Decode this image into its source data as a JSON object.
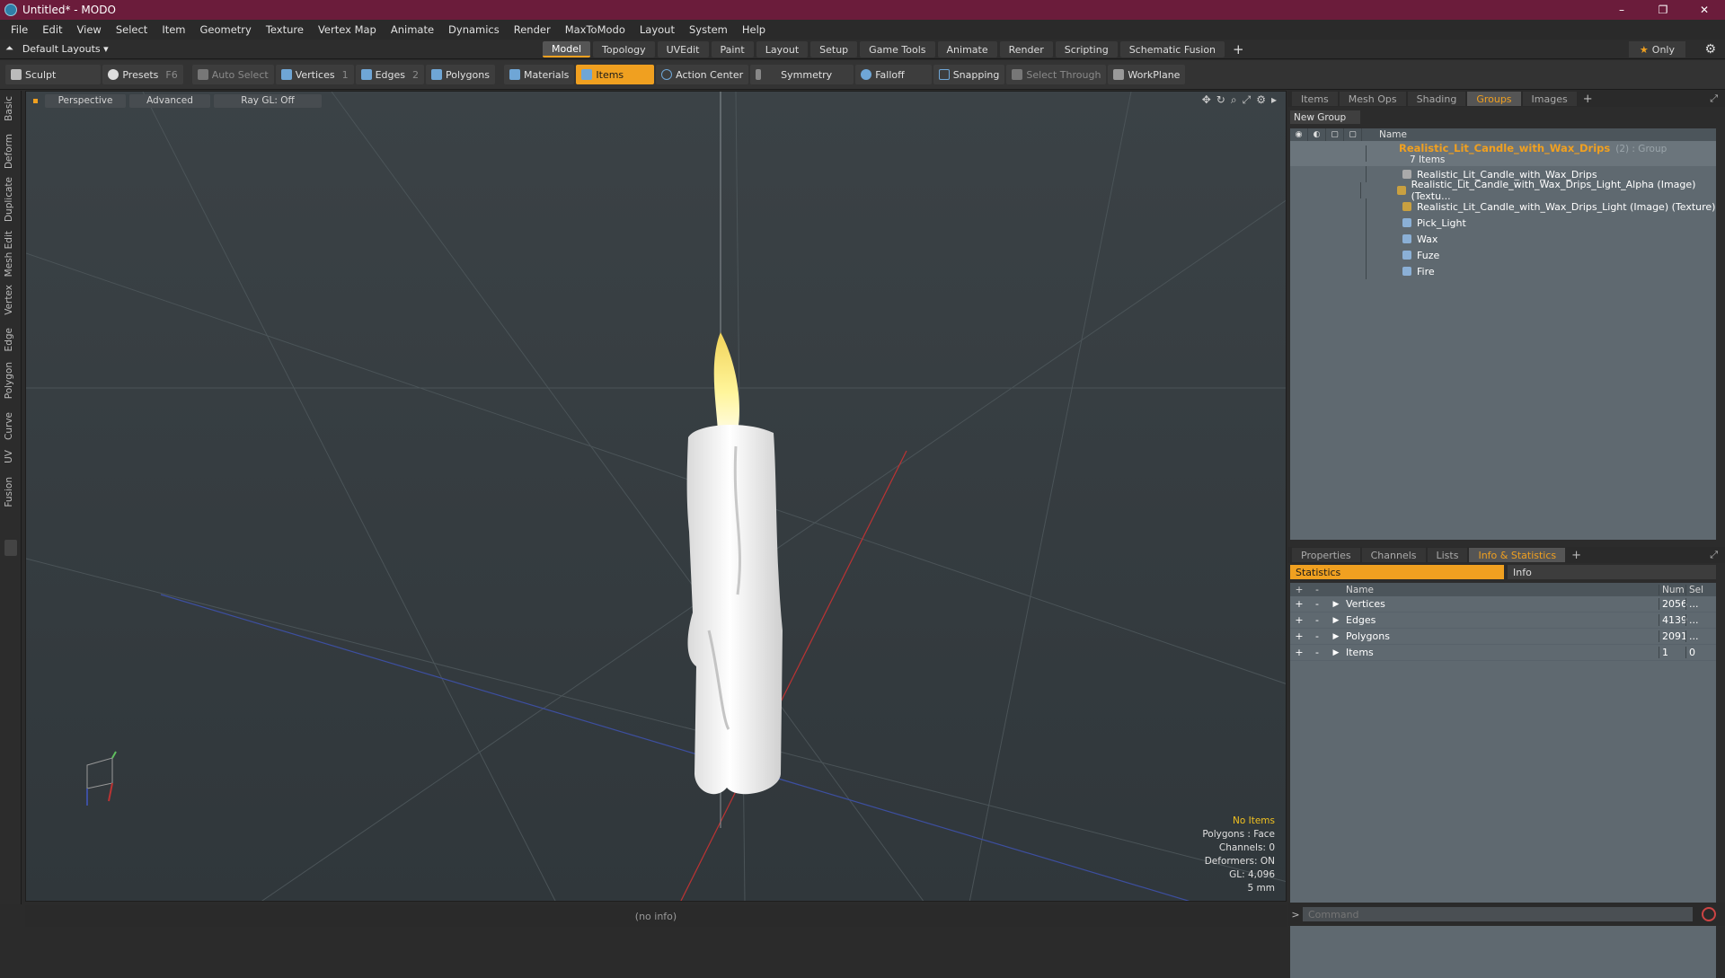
{
  "window": {
    "title": "Untitled* - MODO",
    "minimize": "–",
    "restore": "❐",
    "close": "✕"
  },
  "menu": [
    "File",
    "Edit",
    "View",
    "Select",
    "Item",
    "Geometry",
    "Texture",
    "Vertex Map",
    "Animate",
    "Dynamics",
    "Render",
    "MaxToModo",
    "Layout",
    "System",
    "Help"
  ],
  "modebar": {
    "layouts": "Default Layouts ▾",
    "tabs": [
      "Model",
      "Topology",
      "UVEdit",
      "Paint",
      "Layout",
      "Setup",
      "Game Tools",
      "Animate",
      "Render",
      "Scripting",
      "Schematic Fusion"
    ],
    "active_tab": "Model",
    "plus": "+",
    "only": "Only",
    "star": "★"
  },
  "toolbar": {
    "sculpt": "Sculpt",
    "presets": "Presets",
    "presets_key": "F6",
    "auto_select": "Auto Select",
    "vertices": "Vertices",
    "vertices_num": "1",
    "edges": "Edges",
    "edges_num": "2",
    "polygons": "Polygons",
    "materials": "Materials",
    "items": "Items",
    "action_center": "Action Center",
    "symmetry": "Symmetry",
    "falloff": "Falloff",
    "snapping": "Snapping",
    "select_through": "Select Through",
    "workplane": "WorkPlane"
  },
  "left_tabs": [
    "Basic",
    "Deform",
    "Duplicate",
    "Mesh Edit",
    "Vertex",
    "Edge",
    "Polygon",
    "Curve",
    "UV",
    "Fusion"
  ],
  "viewport": {
    "view": "Perspective",
    "advanced": "Advanced",
    "raygl": "Ray GL: Off",
    "info": {
      "items": "No Items",
      "polygons": "Polygons : Face",
      "channels": "Channels: 0",
      "deformers": "Deformers: ON",
      "gl": "GL: 4,096",
      "unit": "5 mm"
    }
  },
  "status": "(no info)",
  "top_panel": {
    "tabs": [
      "Items",
      "Mesh Ops",
      "Shading",
      "Groups",
      "Images"
    ],
    "active": "Groups",
    "new_group": "New Group",
    "name_col": "Name",
    "group": {
      "name": "Realistic_Lit_Candle_with_Wax_Drips",
      "sub": "(2) : Group",
      "count": "7 Items"
    },
    "items": [
      "Realistic_Lit_Candle_with_Wax_Drips",
      "Realistic_Lit_Candle_with_Wax_Drips_Light_Alpha (Image) (Textu...",
      "Realistic_Lit_Candle_with_Wax_Drips_Light (Image) (Texture)",
      "Pick_Light",
      "Wax",
      "Fuze",
      "Fire"
    ]
  },
  "bottom_panel": {
    "tabs": [
      "Properties",
      "Channels",
      "Lists",
      "Info & Statistics"
    ],
    "active": "Info & Statistics",
    "statistics": "Statistics",
    "info": "Info",
    "cols": {
      "name": "Name",
      "num": "Num",
      "sel": "Sel"
    },
    "rows": [
      {
        "name": "Vertices",
        "num": "2056",
        "sel": "..."
      },
      {
        "name": "Edges",
        "num": "4139",
        "sel": "..."
      },
      {
        "name": "Polygons",
        "num": "2091",
        "sel": "..."
      },
      {
        "name": "Items",
        "num": "1",
        "sel": "0"
      }
    ]
  },
  "command": {
    "prompt": ">",
    "placeholder": "Command"
  }
}
